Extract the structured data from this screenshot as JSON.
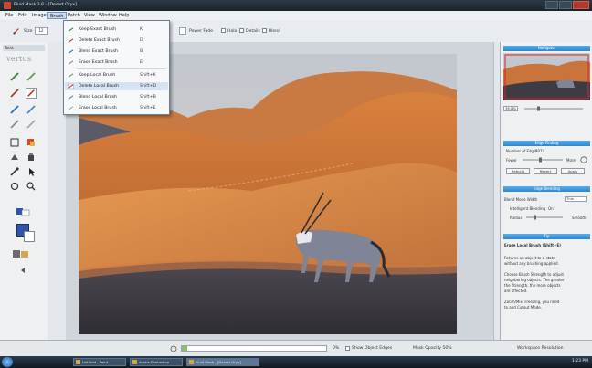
{
  "window": {
    "title": "Fluid Mask 3.6 - [Desert Oryx]"
  },
  "menu": [
    "File",
    "Edit",
    "Image",
    "Brush",
    "Patch",
    "View",
    "Window",
    "Help"
  ],
  "options": {
    "size_label": "Size",
    "size_value": "12",
    "power_fade_label": "Power Fade",
    "checks": [
      "Halo",
      "Details",
      "Blend"
    ]
  },
  "brush_menu": {
    "items": [
      {
        "label": "Keep Exact Brush",
        "shortcut": "K"
      },
      {
        "label": "Delete Exact Brush",
        "shortcut": "D"
      },
      {
        "label": "Blend Exact Brush",
        "shortcut": "B"
      },
      {
        "label": "Erase Exact Brush",
        "shortcut": "E"
      },
      {
        "label": "Keep Local Brush",
        "shortcut": "Shift+K"
      },
      {
        "label": "Delete Local Brush",
        "shortcut": "Shift+D"
      },
      {
        "label": "Blend Local Brush",
        "shortcut": "Shift+B"
      },
      {
        "label": "Erase Local Brush",
        "shortcut": "Shift+E"
      }
    ]
  },
  "toolbox": {
    "header": "Tools",
    "logo": "vertus"
  },
  "navigator": {
    "title": "Navigator",
    "zoom": "36.8%"
  },
  "edge_finding": {
    "title": "Edge Finding",
    "number_of_edges_label": "Number of Edges",
    "number_of_edges": "5074",
    "fewer_label": "Fewer",
    "more_label": "More",
    "buttons": [
      "Rebuild",
      "Revert",
      "Apply"
    ]
  },
  "edge_blending": {
    "title": "Edge Blending",
    "blend_mode_label": "Blend Mode Width",
    "blend_mode_value": "Thin",
    "intelligent_blending_label": "Intelligent Blending",
    "intelligent_blending_value": "On",
    "radius_label": "Radius",
    "smooth_label": "Smooth"
  },
  "tip": {
    "title": "Tip",
    "heading": "Erase Local Brush (Shift+E)",
    "lines": [
      "Returns an object to a state",
      "without any brushing applied.",
      "Choose Brush Strength to adjust",
      "neighboring objects. The greater",
      "the Strength, the more objects",
      "are affected.",
      "Zoom/Mix, Freezing, you need",
      "to add Cutout Mode."
    ]
  },
  "status": {
    "zoom": "0%",
    "progress": 0.04,
    "show_object_edges": "Show Object Edges",
    "mask_opacity": "Mask Opacity 50%",
    "workspace": "Workspace Resolution"
  },
  "taskbar": {
    "tasks": [
      "Untitled - Paint",
      "Adobe Photoshop",
      "Fluid Mask - [Desert Oryx]"
    ],
    "clock": "1:23 PM"
  }
}
